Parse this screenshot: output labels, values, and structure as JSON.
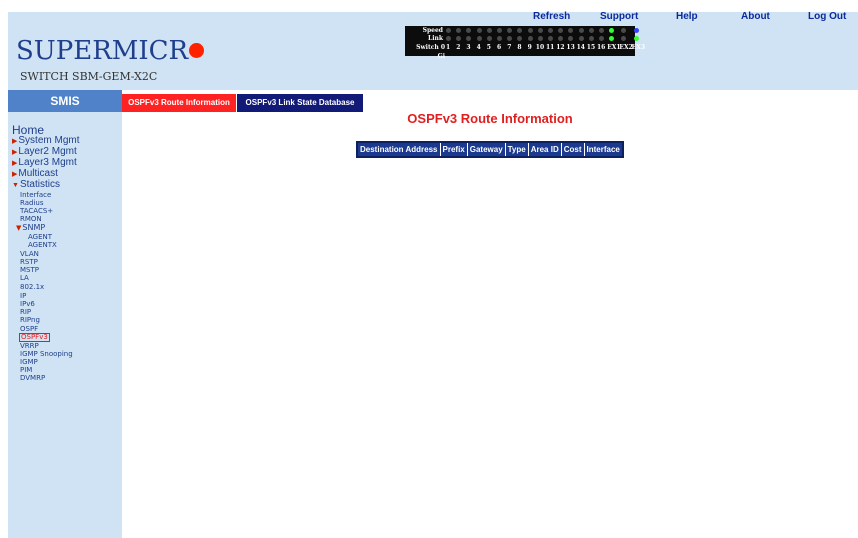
{
  "top_links": [
    "Refresh",
    "Support",
    "Help",
    "About",
    "Log Out"
  ],
  "logo": {
    "text": "SUPERMICR",
    "accent": "#ff2200"
  },
  "model": "SWITCH SBM-GEM-X2C",
  "ports": {
    "row_speed": "Speed",
    "row_link": "Link",
    "row_switch": "Switch 0 Gi",
    "numbers": [
      "1",
      "2",
      "3",
      "4",
      "5",
      "6",
      "7",
      "8",
      "9",
      "10",
      "11",
      "12",
      "13",
      "14",
      "15",
      "16",
      "EX1",
      "EX2",
      "EX3"
    ],
    "active_color": "#33ff33",
    "blue_color": "#3344ff"
  },
  "smis_label": "SMIS",
  "tabs": [
    {
      "label": "OSPFv3 Route Information",
      "active": true
    },
    {
      "label": "OSPFv3 Link State Database",
      "active": false
    }
  ],
  "nav": {
    "home": "Home",
    "top_items": [
      "System Mgmt",
      "Layer2 Mgmt",
      "Layer3 Mgmt",
      "Multicast",
      "Statistics"
    ],
    "stats_items": [
      "Interface",
      "Radius",
      "TACACS+",
      "RMON"
    ],
    "snmp": "SNMP",
    "snmp_items": [
      "AGENT",
      "AGENTX"
    ],
    "stats_items2": [
      "VLAN",
      "RSTP",
      "MSTP",
      "LA",
      "802.1x",
      "IP",
      "IPv6",
      "RIP",
      "RIPng",
      "OSPF",
      "OSPFv3",
      "VRRP",
      "IGMP Snooping",
      "IGMP",
      "PIM",
      "DVMRP"
    ],
    "selected": "OSPFv3"
  },
  "page_title": "OSPFv3 Route Information",
  "table_headers": [
    "Destination Address",
    "Prefix",
    "Gateway",
    "Type",
    "Area ID",
    "Cost",
    "Interface"
  ],
  "colors": {
    "header_bg": "#cfe3f4",
    "title_red": "#e02020",
    "tab_active": "#ff2222",
    "tab_inactive": "#121a78",
    "table_header": "#1b3a8f"
  }
}
